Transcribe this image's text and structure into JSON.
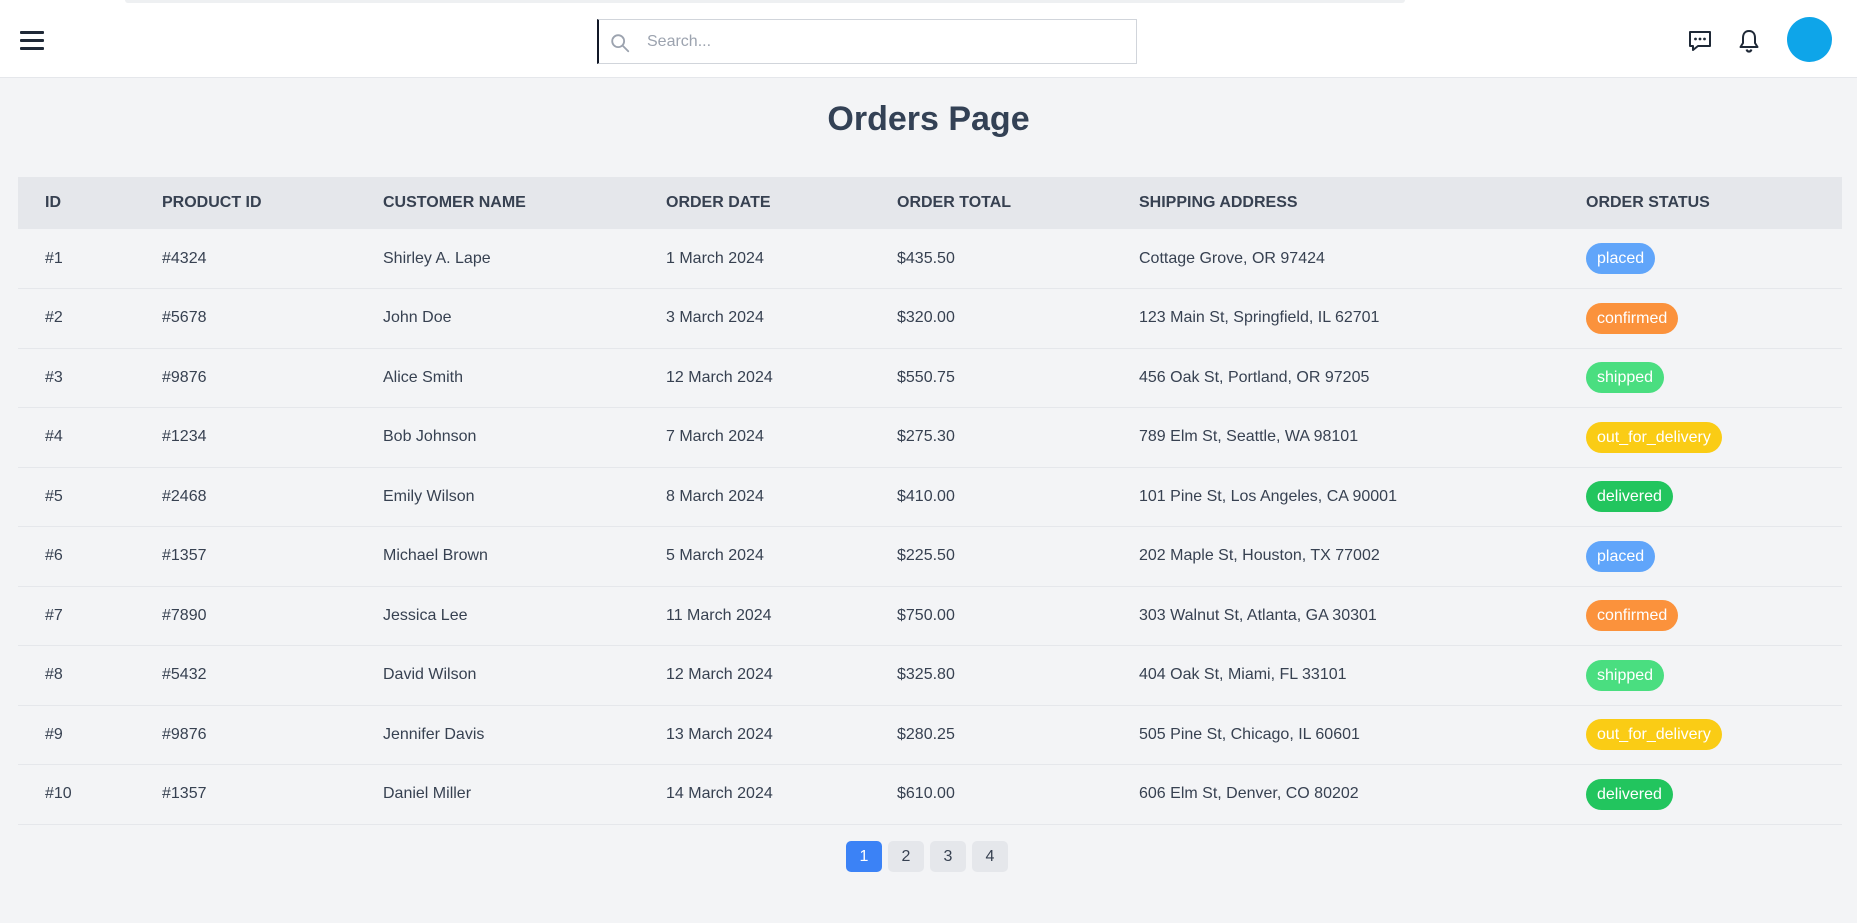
{
  "header": {
    "menu_icon": "hamburger-menu-icon",
    "search": {
      "placeholder": "Search...",
      "value": "",
      "icon": "search-icon"
    },
    "icons": [
      "chat-icon",
      "bell-icon"
    ],
    "avatar_color": "#0ea5e9"
  },
  "main": {
    "title": "Orders Page",
    "columns": [
      "ID",
      "PRODUCT ID",
      "CUSTOMER NAME",
      "ORDER DATE",
      "ORDER TOTAL",
      "SHIPPING ADDRESS",
      "ORDER STATUS"
    ],
    "rows": [
      {
        "id": "#1",
        "product_id": "#4324",
        "customer": "Shirley A. Lape",
        "date": "1 March 2024",
        "total": "$435.50",
        "address": "Cottage Grove, OR 97424",
        "status": "placed"
      },
      {
        "id": "#2",
        "product_id": "#5678",
        "customer": "John Doe",
        "date": "3 March 2024",
        "total": "$320.00",
        "address": "123 Main St, Springfield, IL 62701",
        "status": "confirmed"
      },
      {
        "id": "#3",
        "product_id": "#9876",
        "customer": "Alice Smith",
        "date": "12 March 2024",
        "total": "$550.75",
        "address": "456 Oak St, Portland, OR 97205",
        "status": "shipped"
      },
      {
        "id": "#4",
        "product_id": "#1234",
        "customer": "Bob Johnson",
        "date": "7 March 2024",
        "total": "$275.30",
        "address": "789 Elm St, Seattle, WA 98101",
        "status": "out_for_delivery"
      },
      {
        "id": "#5",
        "product_id": "#2468",
        "customer": "Emily Wilson",
        "date": "8 March 2024",
        "total": "$410.00",
        "address": "101 Pine St, Los Angeles, CA 90001",
        "status": "delivered"
      },
      {
        "id": "#6",
        "product_id": "#1357",
        "customer": "Michael Brown",
        "date": "5 March 2024",
        "total": "$225.50",
        "address": "202 Maple St, Houston, TX 77002",
        "status": "placed"
      },
      {
        "id": "#7",
        "product_id": "#7890",
        "customer": "Jessica Lee",
        "date": "11 March 2024",
        "total": "$750.00",
        "address": "303 Walnut St, Atlanta, GA 30301",
        "status": "confirmed"
      },
      {
        "id": "#8",
        "product_id": "#5432",
        "customer": "David Wilson",
        "date": "12 March 2024",
        "total": "$325.80",
        "address": "404 Oak St, Miami, FL 33101",
        "status": "shipped"
      },
      {
        "id": "#9",
        "product_id": "#9876",
        "customer": "Jennifer Davis",
        "date": "13 March 2024",
        "total": "$280.25",
        "address": "505 Pine St, Chicago, IL 60601",
        "status": "out_for_delivery"
      },
      {
        "id": "#10",
        "product_id": "#1357",
        "customer": "Daniel Miller",
        "date": "14 March 2024",
        "total": "$610.00",
        "address": "606 Elm St, Denver, CO 80202",
        "status": "delivered"
      }
    ],
    "status_colors": {
      "placed": "#60a5fa",
      "confirmed": "#fb923c",
      "shipped": "#4ade80",
      "out_for_delivery": "#facc15",
      "delivered": "#22c55e"
    }
  },
  "pagination": {
    "pages": [
      "1",
      "2",
      "3",
      "4"
    ],
    "current": "1"
  }
}
